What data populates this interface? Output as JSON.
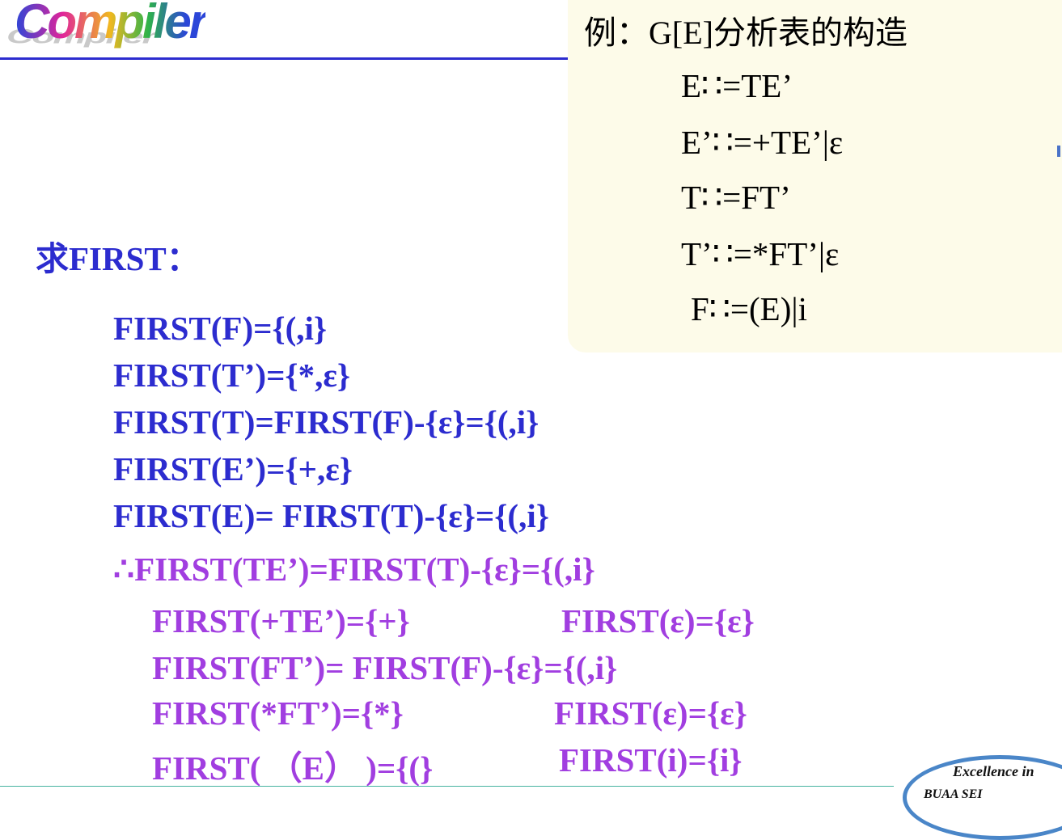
{
  "logo": {
    "text": "Compiler"
  },
  "grammar": {
    "title_prefix": "例：",
    "title_symbol": "G[E]",
    "title_suffix": "分析表的构造",
    "productions": [
      "E∷=TE’",
      "E’∷=+TE’|ε",
      "T∷=FT’",
      "T’∷=*FT’|ε",
      "F∷=(E)|i"
    ]
  },
  "heading": {
    "zh": "求",
    "en": "FIRST："
  },
  "first_sets": [
    "FIRST(F)={(,i}",
    "FIRST(T’)={*,ε}",
    "FIRST(T)=FIRST(F)-{ε}={(,i}",
    "FIRST(E’)={+,ε}",
    "FIRST(E)= FIRST(T)-{ε}={(,i}"
  ],
  "derived": {
    "line1": "∴FIRST(TE’)=FIRST(T)-{ε}={(,i}",
    "line2_left": "FIRST(+TE’)={+}",
    "line2_right": "FIRST(ε)={ε}",
    "line3": "FIRST(FT’)= FIRST(F)-{ε}={(,i}",
    "line4_left": "FIRST(*FT’)={*}",
    "line4_right": "FIRST(ε)={ε}",
    "line5_left": "FIRST( （E） )={(}",
    "line5_right": "FIRST(i)={i}"
  },
  "seal": {
    "line1": "Excellence in",
    "line2": "BUAA  SEI"
  },
  "colors": {
    "blue": "#2c2ccf",
    "purple": "#a13ee0",
    "box_bg": "#fdfbe9"
  }
}
